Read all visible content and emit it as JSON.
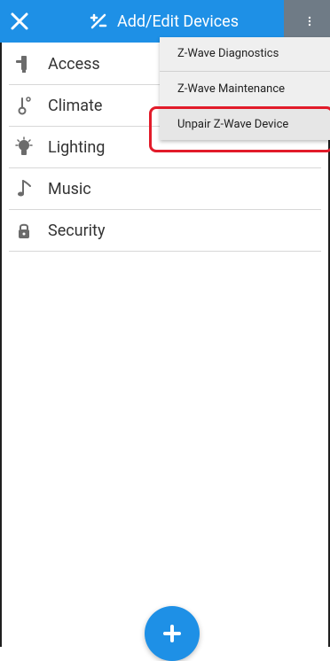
{
  "header": {
    "title": "Add/Edit Devices"
  },
  "device_categories": [
    {
      "label": "Access",
      "icon": "access-icon"
    },
    {
      "label": "Climate",
      "icon": "thermometer-icon"
    },
    {
      "label": "Lighting",
      "icon": "lightbulb-icon"
    },
    {
      "label": "Music",
      "icon": "music-note-icon"
    },
    {
      "label": "Security",
      "icon": "lock-icon"
    }
  ],
  "menu": {
    "items": [
      {
        "label": "Z-Wave Diagnostics"
      },
      {
        "label": "Z-Wave Maintenance"
      },
      {
        "label": "Unpair Z-Wave Device"
      }
    ]
  },
  "colors": {
    "header_blue": "#1e90e6",
    "kebab_gray": "#6f7b86",
    "highlight_red": "#e21b2a"
  }
}
